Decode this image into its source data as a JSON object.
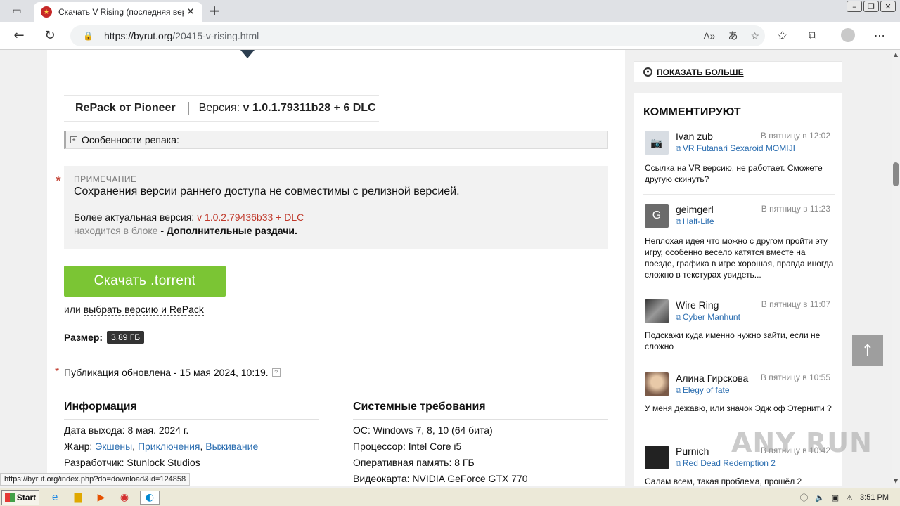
{
  "browser": {
    "tab_title": "Скачать V Rising (последняя вер",
    "url_host": "https://byrut.org",
    "url_path": "/20415-v-rising.html"
  },
  "main": {
    "repack_label": "RePack от Pioneer",
    "version_label": "Версия: ",
    "version_value": "v 1.0.1.79311b28 + 6 DLC",
    "spoiler_label": "Особенности репака:",
    "note": {
      "label": "ПРИМЕЧАНИЕ",
      "text": "Сохранения версии раннего доступа не совместимы с релизной версией.",
      "newer_prefix": "Более актуальная версия: ",
      "newer_version": "v 1.0.2.79436b33 + DLC",
      "block_link": "находится в блоке",
      "block_suffix": " - Дополнительные раздачи."
    },
    "download_button": "Скачать .torrent",
    "or_text": "или ",
    "choose_link": "выбрать версию и RePack",
    "size_label": "Размер:",
    "size_value": "3.89 ГБ",
    "published": "Публикация обновлена - 15 мая 2024, 10:19.",
    "info": {
      "title": "Информация",
      "release_label": "Дата выхода: ",
      "release_value": "8 мая. 2024 г.",
      "genre_label": "Жанр: ",
      "genres": [
        "Экшены",
        "Приключения",
        "Выживание"
      ],
      "genre_sep": ", ",
      "developer_label": "Разработчик: ",
      "developer_value": "Stunlock Studios"
    },
    "sysreq": {
      "title": "Системные требования",
      "os": "ОС: Windows 7, 8, 10 (64 бита)",
      "cpu": "Процессор: Intel Core i5",
      "ram": "Оперативная память: 8 ГБ",
      "gpu": "Видеокарта: NVIDIA GeForce GTX 770"
    }
  },
  "sidebar": {
    "show_more": "ПОКАЗАТЬ БОЛЬШЕ",
    "comments_title": "КОММЕНТИРУЮТ",
    "comments": [
      {
        "name": "Ivan zub",
        "time": "В пятницу в 12:02",
        "game": "VR Futanari Sexaroid MOMIJI",
        "text": "Ссылка на VR версию, не работает. Сможете другую скинуть?",
        "avatar_letter": "",
        "avatar_color": "#d8dde3"
      },
      {
        "name": "geimgerl",
        "time": "В пятницу в 11:23",
        "game": "Half-Life",
        "text": "Неплохая идея что можно с другом пройти эту игру, особенно весело катятся вместе на поезде, графика в игре хорошая, правда иногда сложно в текстурах увидеть...",
        "avatar_letter": "G",
        "avatar_color": "#6b6b6b"
      },
      {
        "name": "Wire Ring",
        "time": "В пятницу в 11:07",
        "game": "Cyber Manhunt",
        "text": "Подскажи куда именно нужно зайти, если не сложно",
        "avatar_letter": "",
        "avatar_color": "#5a5a5a"
      },
      {
        "name": "Алина Гирскова",
        "time": "В пятницу в 10:55",
        "game": "Elegy of fate",
        "text": "У меня дежавю, или значок Эдж оф Этернити ?",
        "avatar_letter": "",
        "avatar_color": "#7a5a48"
      },
      {
        "name": "Purnich",
        "time": "В пятницу в 10:42",
        "game": "Red Dead Redemption 2",
        "text": "Салам всем, такая проблема, прошёл 2",
        "avatar_letter": "",
        "avatar_color": "#222222"
      }
    ]
  },
  "status_url": "https://byrut.org/index.php?do=download&id=124858",
  "watermark": "ANY RUN",
  "taskbar": {
    "start": "Start",
    "clock": "3:51 PM"
  },
  "colors": {
    "accent_green": "#7bc534",
    "link_blue": "#2a6db0",
    "note_red": "#c0392b"
  }
}
